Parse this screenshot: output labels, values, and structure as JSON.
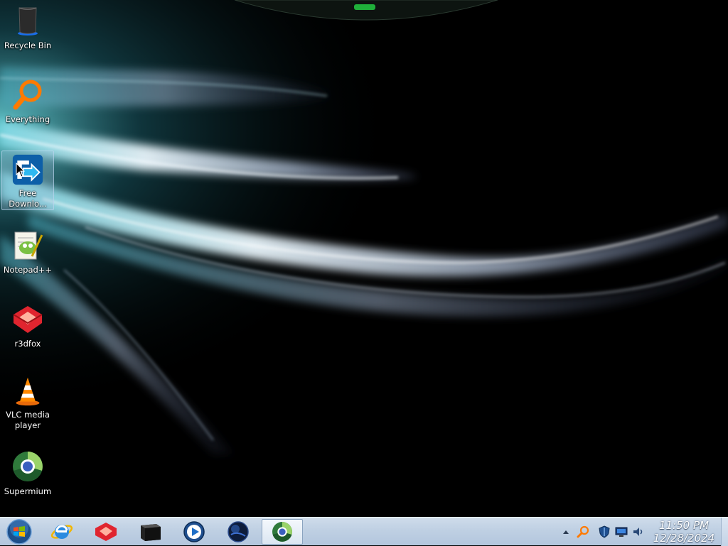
{
  "desktop": {
    "icons": [
      {
        "label": "Recycle Bin",
        "icon": "recycle-bin-icon"
      },
      {
        "label": "Everything",
        "icon": "everything-search-icon"
      },
      {
        "label": "Free Downlo...",
        "icon": "free-download-manager-icon",
        "selected": true
      },
      {
        "label": "Notepad++",
        "icon": "notepad-plus-plus-icon"
      },
      {
        "label": "r3dfox",
        "icon": "r3dfox-icon"
      },
      {
        "label": "VLC media player",
        "icon": "vlc-icon"
      },
      {
        "label": "Supermium",
        "icon": "supermium-icon"
      }
    ]
  },
  "taskbar": {
    "start": "start-orb-icon",
    "pinned": [
      "internet-explorer-icon",
      "r3dfox-icon",
      "terminal-icon",
      "media-player-icon",
      "browser-globe-icon",
      "supermium-icon"
    ],
    "active_item": "supermium-icon",
    "tray": [
      "show-hidden-icons-arrow",
      "everything-tray-icon",
      "security-shield-icon",
      "network-icon",
      "volume-icon"
    ],
    "clock": {
      "time": "11:50 PM",
      "date": "12/28/2024"
    }
  },
  "colors": {
    "taskbar": "#c3d3e6",
    "wallpaper_bg": "#000000",
    "wallpaper_streak": "#cfe6f2"
  }
}
